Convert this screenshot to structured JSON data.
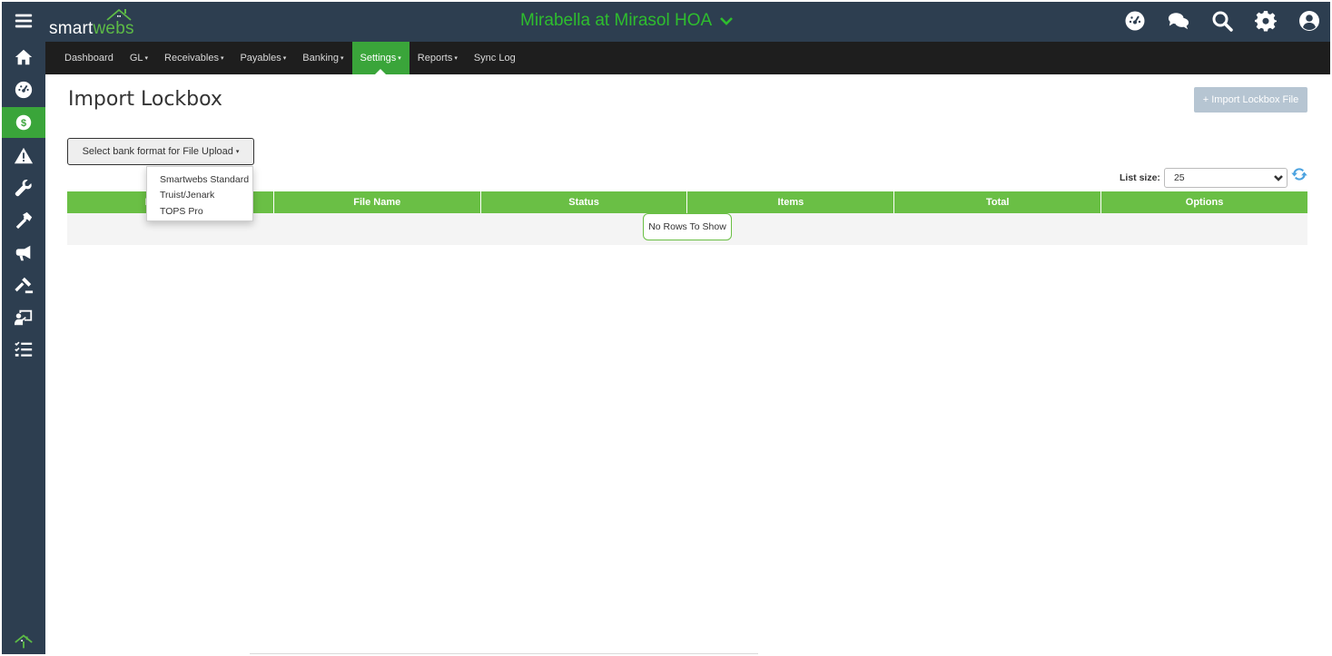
{
  "header": {
    "logo_prefix": "smart",
    "logo_suffix": "webs",
    "hoa_name": "Mirabella at Mirasol HOA",
    "icons": [
      "dashboard-icon",
      "chat-icon",
      "search-icon",
      "gear-icon",
      "user-icon"
    ]
  },
  "sidebar": {
    "items": [
      {
        "name": "menu-icon"
      },
      {
        "name": "home-icon"
      },
      {
        "name": "dashboard-icon"
      },
      {
        "name": "dollar-icon",
        "active": true
      },
      {
        "name": "warning-icon"
      },
      {
        "name": "wrench-icon"
      },
      {
        "name": "hammer-icon"
      },
      {
        "name": "megaphone-icon"
      },
      {
        "name": "gavel-icon"
      },
      {
        "name": "presentation-icon"
      },
      {
        "name": "checklist-icon"
      }
    ]
  },
  "nav": {
    "items": [
      {
        "label": "Dashboard",
        "caret": false
      },
      {
        "label": "GL",
        "caret": true
      },
      {
        "label": "Receivables",
        "caret": true
      },
      {
        "label": "Payables",
        "caret": true
      },
      {
        "label": "Banking",
        "caret": true
      },
      {
        "label": "Settings",
        "caret": true,
        "active": true
      },
      {
        "label": "Reports",
        "caret": true
      },
      {
        "label": "Sync Log",
        "caret": false
      }
    ],
    "caret_glyph": "▾"
  },
  "main": {
    "title": "Import Lockbox",
    "import_button": "+ Import Lockbox File",
    "bank_format_button": "Select bank format for File Upload",
    "bank_formats": [
      "Smartwebs Standard",
      "Truist/Jenark",
      "TOPS Pro"
    ],
    "list_size_label": "List size:",
    "list_size_value": "25",
    "columns": [
      "Processed",
      "File Name",
      "Status",
      "Items",
      "Total",
      "Options"
    ],
    "empty_message": "No Rows To Show"
  },
  "colors": {
    "header_bg": "#2d3e50",
    "accent_green": "#3aa53a",
    "grid_header_green": "#6abf45",
    "hoa_title": "#2ebd2e",
    "nav_bg": "#1e1e1e"
  }
}
